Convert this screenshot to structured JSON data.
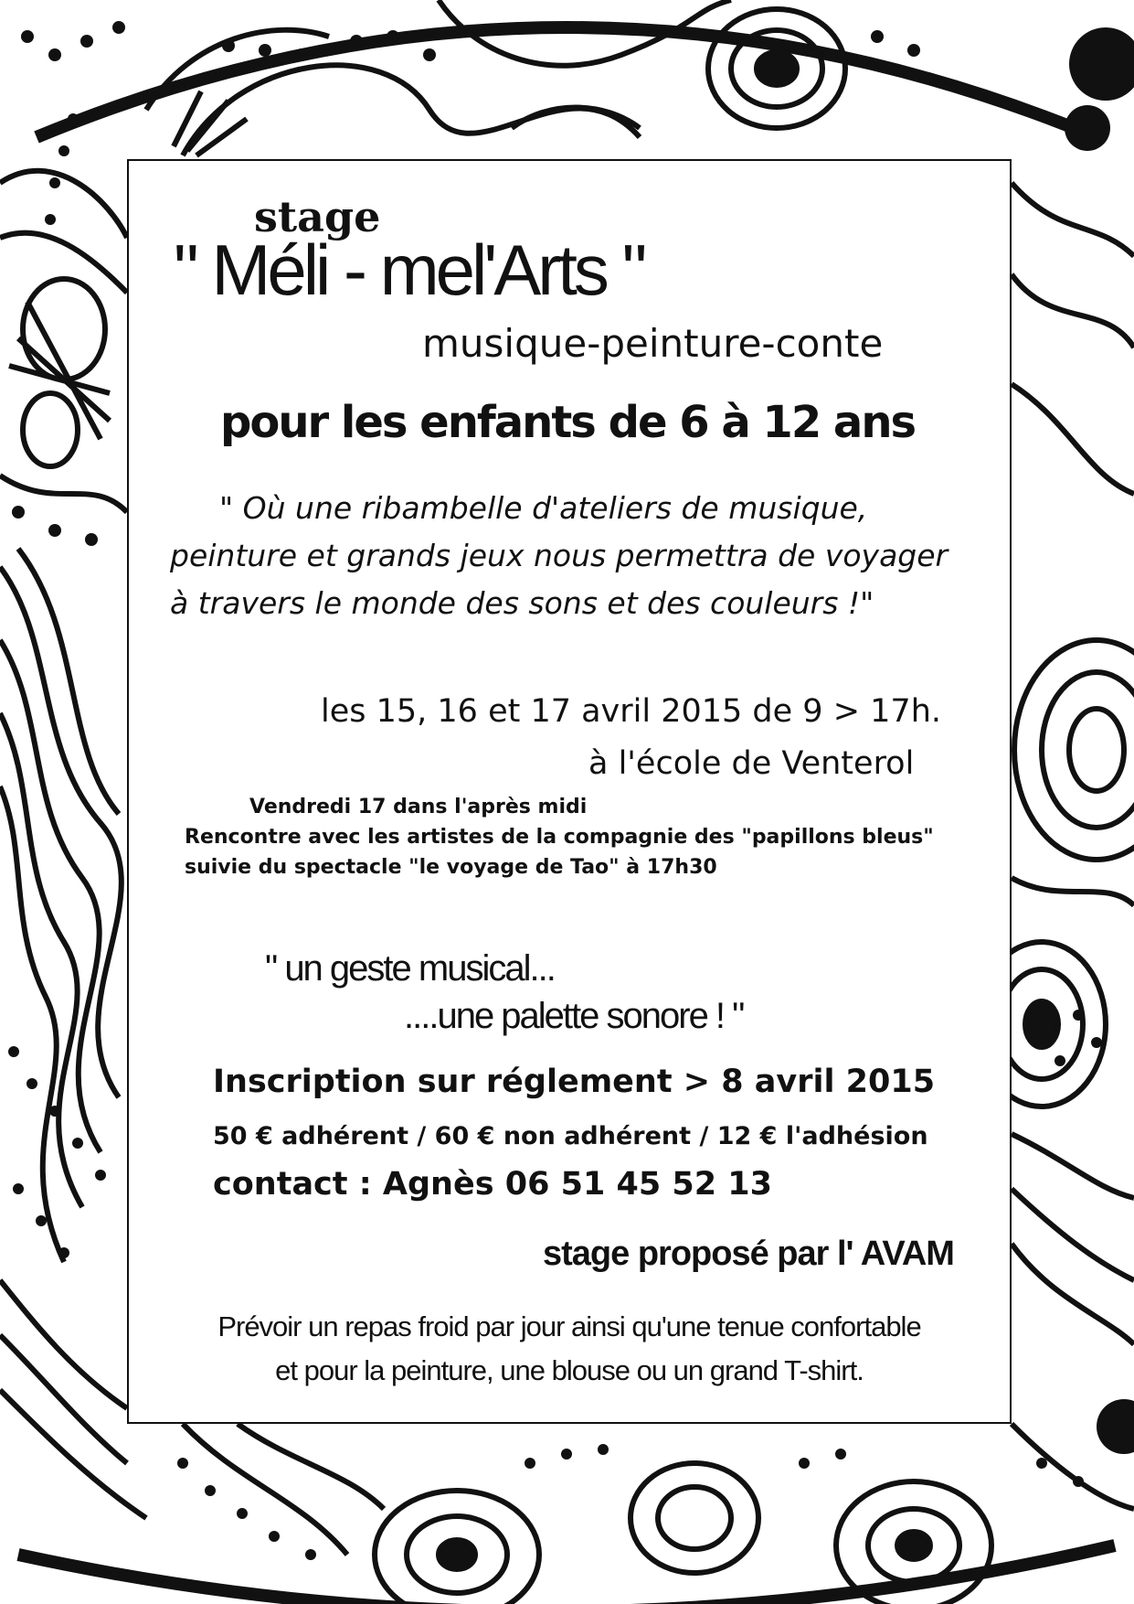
{
  "flyer": {
    "stage_word": "stage",
    "title": "\" Méli - mel'Arts \"",
    "subtitle": "musique-peinture-conte",
    "audience": "pour les enfants de 6 à 12 ans",
    "quote_lines": [
      "\" Où une ribambelle d'ateliers de musique,",
      "peinture et grands jeux nous permettra de voyager",
      "à travers le monde des sons et des couleurs !\""
    ],
    "dates": "les 15, 16 et 17 avril 2015 de 9 > 17h.",
    "venue": "à l'école de Venterol",
    "event_lines": [
      "Vendredi 17 dans l'après midi",
      "Rencontre avec les artistes de la compagnie des \"papillons bleus\"",
      "suivie du spectacle \"le voyage de Tao\" à 17h30"
    ],
    "motto_lines": [
      "\" un geste musical...",
      "....une palette sonore ! \""
    ],
    "registration": "Inscription sur réglement > 8 avril 2015",
    "prices": "50 € adhérent / 60 € non adhérent / 12 € l'adhésion",
    "contact": "contact : Agnès 06 51 45 52 13",
    "organizer": "stage proposé par l' AVAM",
    "note_lines": [
      "Prévoir un repas froid par jour  ainsi qu'une tenue confortable",
      "et pour la peinture, une blouse ou un grand T-shirt."
    ]
  },
  "colors": {
    "ink": "#111111",
    "paper": "#ffffff"
  },
  "background_art": "black-and-white aboriginal style dot and swirl pattern"
}
